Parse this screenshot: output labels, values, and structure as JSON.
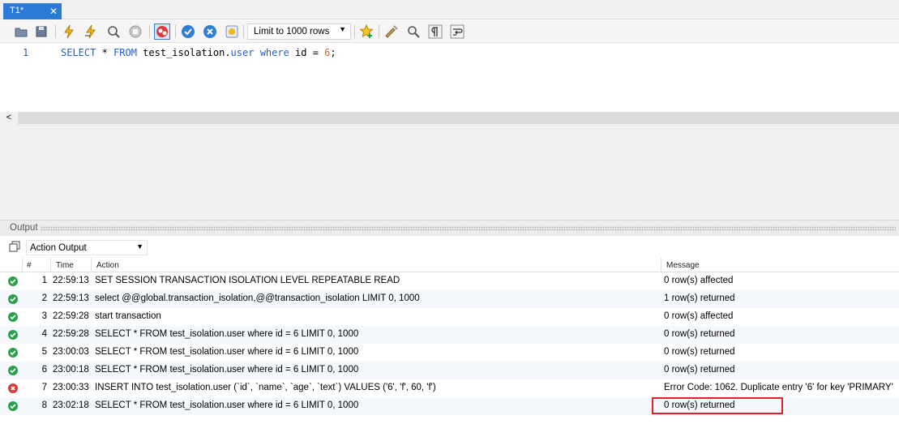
{
  "tab": {
    "label": "T1*",
    "close": "✕"
  },
  "toolbar": {
    "limit_label": "Limit to 1000 rows"
  },
  "editor": {
    "line_number": "1",
    "code": {
      "t1": "SELECT",
      "t2": " * ",
      "t3": "FROM",
      "t4": " test_isolation.",
      "t5": "user",
      "t6": " ",
      "t7": "where",
      "t8": " id = ",
      "t9": "6",
      "t10": ";"
    }
  },
  "output": {
    "title": "Output",
    "selector_value": "Action Output",
    "columns": {
      "num": "#",
      "time": "Time",
      "action": "Action",
      "message": "Message"
    },
    "rows": [
      {
        "status": "ok",
        "num": "1",
        "time": "22:59:13",
        "action": "SET SESSION TRANSACTION ISOLATION LEVEL REPEATABLE READ",
        "message": "0 row(s) affected"
      },
      {
        "status": "ok",
        "num": "2",
        "time": "22:59:13",
        "action": "select @@global.transaction_isolation,@@transaction_isolation LIMIT 0, 1000",
        "message": "1 row(s) returned"
      },
      {
        "status": "ok",
        "num": "3",
        "time": "22:59:28",
        "action": "start transaction",
        "message": "0 row(s) affected"
      },
      {
        "status": "ok",
        "num": "4",
        "time": "22:59:28",
        "action": "SELECT * FROM test_isolation.user where id = 6 LIMIT 0, 1000",
        "message": "0 row(s) returned"
      },
      {
        "status": "ok",
        "num": "5",
        "time": "23:00:03",
        "action": "SELECT * FROM test_isolation.user where id = 6 LIMIT 0, 1000",
        "message": "0 row(s) returned"
      },
      {
        "status": "ok",
        "num": "6",
        "time": "23:00:18",
        "action": "SELECT * FROM test_isolation.user where id = 6 LIMIT 0, 1000",
        "message": "0 row(s) returned"
      },
      {
        "status": "error",
        "num": "7",
        "time": "23:00:33",
        "action": "INSERT INTO test_isolation.user (`id`, `name`, `age`, `text`) VALUES ('6', 'f', 60, 'f')",
        "message": "Error Code: 1062. Duplicate entry '6' for key 'PRIMARY'"
      },
      {
        "status": "ok",
        "num": "8",
        "time": "23:02:18",
        "action": "SELECT * FROM test_isolation.user where id = 6 LIMIT 0, 1000",
        "message": "0 row(s) returned"
      }
    ]
  },
  "colors": {
    "accent": "#2b7bd6",
    "ok": "#2aa04a",
    "error": "#d83a3a",
    "highlight": "#d9252a"
  }
}
